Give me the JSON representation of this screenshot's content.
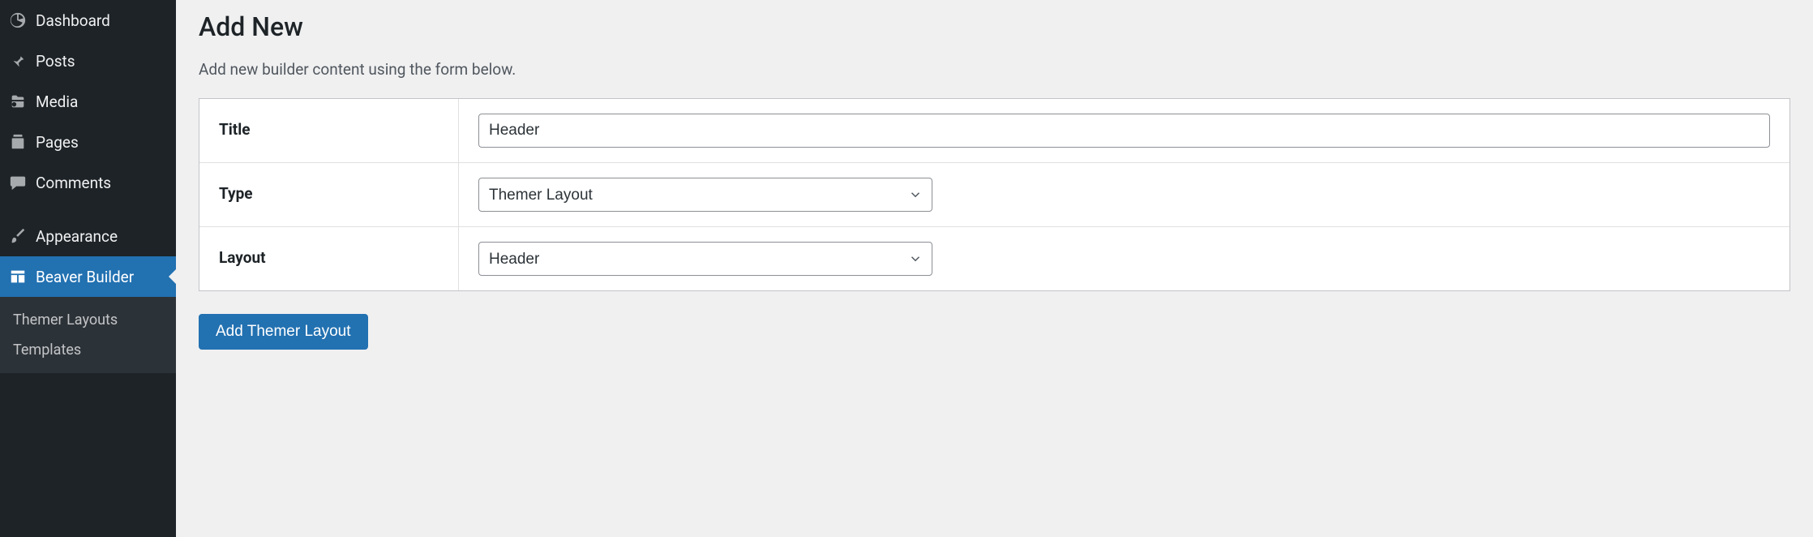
{
  "sidebar": {
    "items": [
      {
        "label": "Dashboard",
        "icon": "dashboard-icon"
      },
      {
        "label": "Posts",
        "icon": "pin-icon"
      },
      {
        "label": "Media",
        "icon": "media-icon"
      },
      {
        "label": "Pages",
        "icon": "pages-icon"
      },
      {
        "label": "Comments",
        "icon": "comment-icon"
      },
      {
        "label": "Appearance",
        "icon": "brush-icon"
      },
      {
        "label": "Beaver Builder",
        "icon": "layout-icon"
      }
    ],
    "submenu": [
      {
        "label": "Themer Layouts"
      },
      {
        "label": "Templates"
      }
    ]
  },
  "page": {
    "title": "Add New",
    "subtitle": "Add new builder content using the form below."
  },
  "form": {
    "title_label": "Title",
    "title_value": "Header",
    "type_label": "Type",
    "type_value": "Themer Layout",
    "layout_label": "Layout",
    "layout_value": "Header",
    "submit_label": "Add Themer Layout"
  }
}
